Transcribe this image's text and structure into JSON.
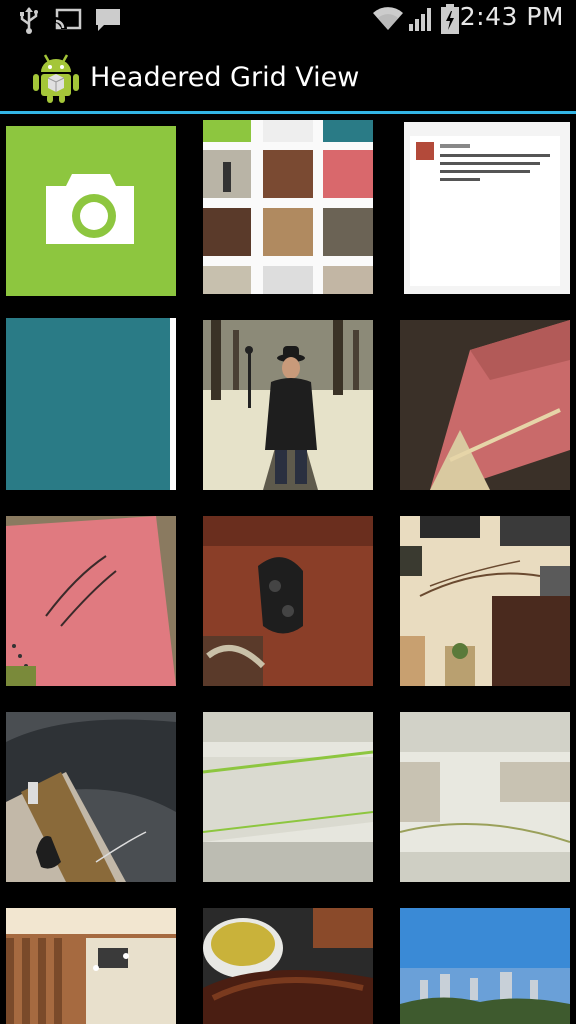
{
  "status_bar": {
    "time": "2:43 PM",
    "icons": [
      "usb-icon",
      "cast-icon",
      "message-icon",
      "wifi-icon",
      "signal-icon",
      "battery-charging-icon"
    ]
  },
  "action_bar": {
    "title": "Headered Grid View",
    "icon": "android-launcher-icon"
  },
  "grid": {
    "items": [
      {
        "name": "camera-tile",
        "type": "icon"
      },
      {
        "name": "photo-screenshot-grid",
        "type": "image"
      },
      {
        "name": "photo-screenshot-post",
        "type": "image"
      },
      {
        "name": "photo-teal-tile",
        "type": "image"
      },
      {
        "name": "photo-man-in-snow",
        "type": "image"
      },
      {
        "name": "photo-pink-fabric",
        "type": "image"
      },
      {
        "name": "photo-pink-notebook",
        "type": "image"
      },
      {
        "name": "photo-game-controller",
        "type": "image"
      },
      {
        "name": "photo-living-room",
        "type": "image"
      },
      {
        "name": "photo-dark-sofa",
        "type": "image"
      },
      {
        "name": "photo-sleep-mattress",
        "type": "image"
      },
      {
        "name": "photo-mattress-detail",
        "type": "image"
      },
      {
        "name": "photo-restaurant",
        "type": "image"
      },
      {
        "name": "photo-food-plate",
        "type": "image"
      },
      {
        "name": "photo-city-skyline",
        "type": "image"
      }
    ]
  },
  "colors": {
    "accent": "#33b5e5",
    "camera_tile": "#8dc63f",
    "teal_tile": "#2a7b86"
  }
}
